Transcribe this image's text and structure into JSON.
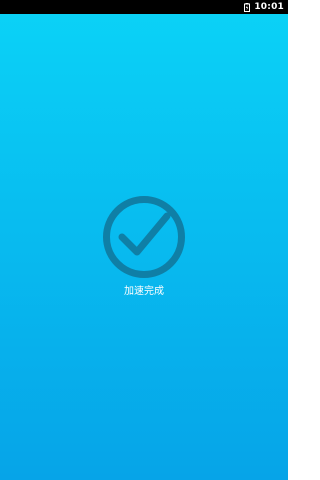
{
  "status_bar": {
    "time": "10:01",
    "battery_icon": "battery-charging-icon"
  },
  "main": {
    "status_icon": "checkmark-circle-icon",
    "result_text": "加速完成"
  },
  "colors": {
    "background_top": "#0bd3f7",
    "background_bottom": "#06a4e8",
    "check_color": "#0f7fa6",
    "text": "#ffffff"
  }
}
